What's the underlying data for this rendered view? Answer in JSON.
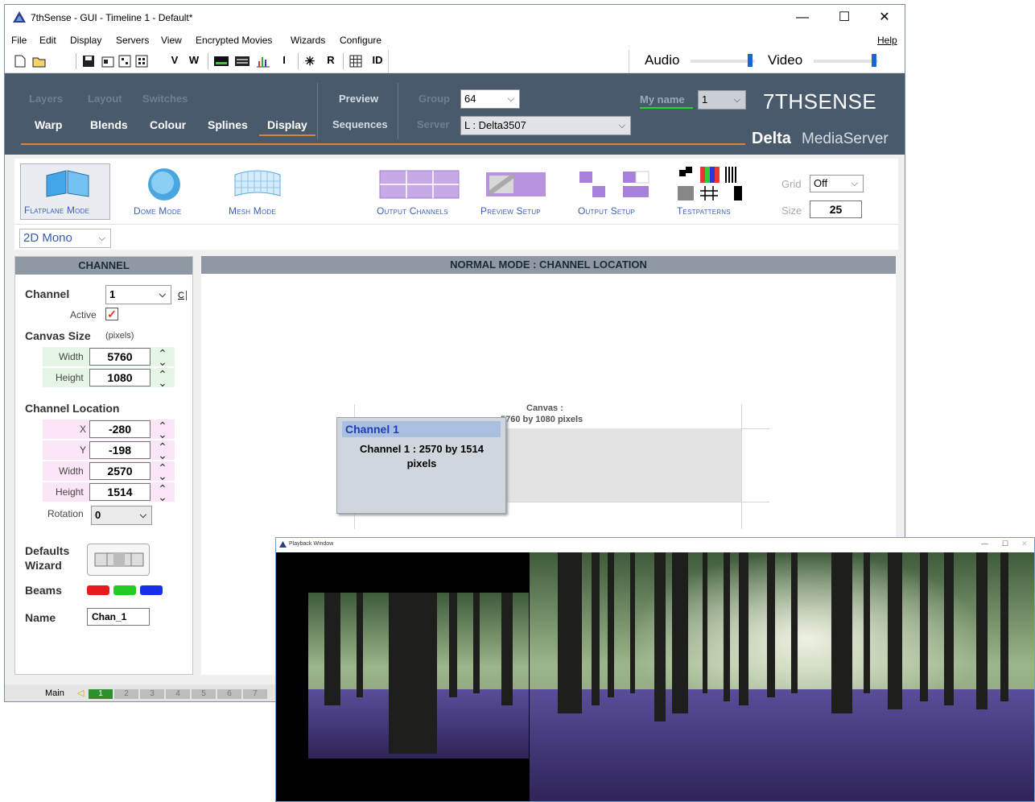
{
  "window": {
    "title": "7thSense -   GUI  - Timeline 1  - Default*",
    "min_glyph": "—",
    "max_glyph": "☐",
    "close_glyph": "✕"
  },
  "menu": [
    "File",
    "Edit",
    "Display",
    "Servers",
    "View",
    "Encrypted Movies",
    "Wizards",
    "Configure"
  ],
  "menu_help": "Help",
  "toolbar": {
    "letters": [
      "V",
      "W",
      "I",
      "R",
      "ID"
    ],
    "audio_label": "Audio",
    "video_label": "Video"
  },
  "header": {
    "dim_tabs": [
      "Layers",
      "Layout",
      "Switches"
    ],
    "tabs": [
      "Warp",
      "Blends",
      "Colour",
      "Splines",
      "Display"
    ],
    "preview": "Preview",
    "sequences": "Sequences",
    "group_label": "Group",
    "group_value": "64",
    "server_label": "Server",
    "server_value": "L : Delta3507",
    "myname_label": "My name",
    "myname_value": "1",
    "brand": "7THSENSE",
    "product_bold": "Delta",
    "product_rest": "MediaServer"
  },
  "modes": {
    "flatplane": "Flatplane Mode",
    "dome": "Dome Mode",
    "mesh": "Mesh Mode",
    "output_channels": "Output Channels",
    "preview_setup": "Preview Setup",
    "output_setup": "Output Setup",
    "testpatterns": "Testpatterns",
    "grid_label": "Grid",
    "grid_value": "Off",
    "size_label": "Size",
    "size_value": "25",
    "view_select": "2D Mono"
  },
  "channel_panel": {
    "heading": "CHANNEL",
    "channel_label": "Channel",
    "channel_value": "1",
    "c_button": "C",
    "active_label": "Active",
    "canvas_size_label": "Canvas Size",
    "pixels_note": "(pixels)",
    "width_label": "Width",
    "width_value": "5760",
    "height_label": "Height",
    "height_value": "1080",
    "location_label": "Channel Location",
    "x_label": "X",
    "x_value": "-280",
    "y_label": "Y",
    "y_value": "-198",
    "loc_width_label": "Width",
    "loc_width_value": "2570",
    "loc_height_label": "Height",
    "loc_height_value": "1514",
    "rotation_label": "Rotation",
    "rotation_value": "0",
    "defaults_wizard": "Defaults\nWizard",
    "beams_label": "Beams",
    "beam_colors": [
      "#e81a1a",
      "#22cc22",
      "#1a2ee8"
    ],
    "name_label": "Name",
    "name_value": "Chan_1"
  },
  "canvas_panel": {
    "heading": "NORMAL MODE : CHANNEL LOCATION",
    "canvas_title": "Canvas :",
    "canvas_dims": "5760 by 1080 pixels",
    "popup_title": "Channel 1",
    "popup_text": "Channel 1 : 2570 by 1514 pixels"
  },
  "statusbar": {
    "main_label": "Main",
    "pages": [
      "1",
      "2",
      "3",
      "4",
      "5",
      "6",
      "7"
    ]
  },
  "playback": {
    "title": "Playback Window"
  }
}
